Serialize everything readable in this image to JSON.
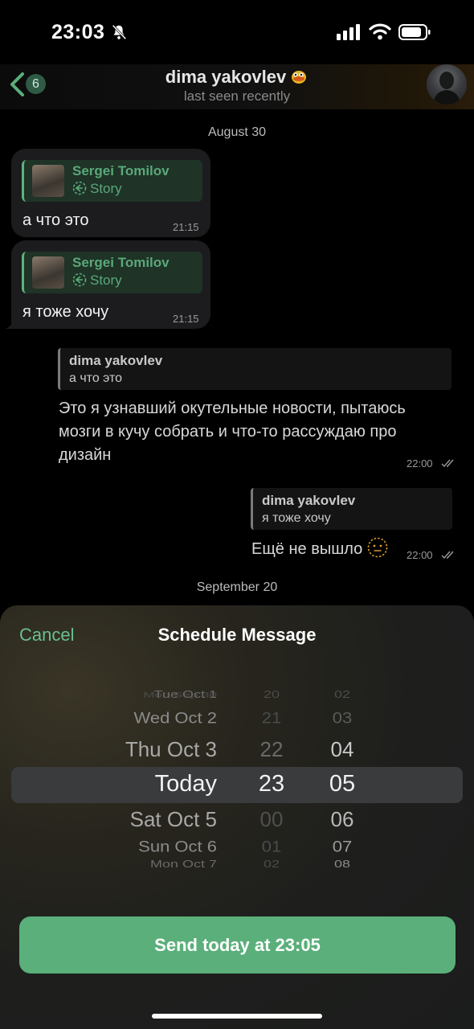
{
  "status_bar": {
    "time": "23:03"
  },
  "header": {
    "unread_count": "6",
    "contact_name": "dima yakovlev",
    "last_seen": "last seen recently"
  },
  "chat": {
    "date1": "August 30",
    "messages_in": [
      {
        "reply_name": "Sergei Tomilov",
        "reply_label": "Story",
        "text": "а что это",
        "time": "21:15"
      },
      {
        "reply_name": "Sergei Tomilov",
        "reply_label": "Story",
        "text": "я тоже хочу",
        "time": "21:15"
      }
    ],
    "messages_out": [
      {
        "reply_name": "dima yakovlev",
        "reply_text": "а что это",
        "text_lines": [
          "Это я узнавший окутельные новости, пытаюсь",
          "мозги в кучу собрать и что-то рассуждаю про",
          "дизайн"
        ],
        "time": "22:00"
      },
      {
        "reply_name": "dima yakovlev",
        "reply_text": "я тоже хочу",
        "text": "Ещё не вышло",
        "time": "22:00"
      }
    ],
    "date2": "September 20"
  },
  "sheet": {
    "cancel_label": "Cancel",
    "title": "Schedule Message",
    "days": [
      "Tue Oct 1",
      "Wed Oct 2",
      "Thu Oct 3",
      "Today",
      "Sat Oct 5",
      "Sun Oct 6",
      "Mon Oct 7"
    ],
    "hours": [
      "20",
      "21",
      "22",
      "23",
      "00",
      "01",
      "02"
    ],
    "minutes": [
      "02",
      "03",
      "04",
      "05",
      "06",
      "07",
      "08"
    ],
    "send_label": "Send today at 23:05",
    "accent_color": "#5aaf7a"
  }
}
